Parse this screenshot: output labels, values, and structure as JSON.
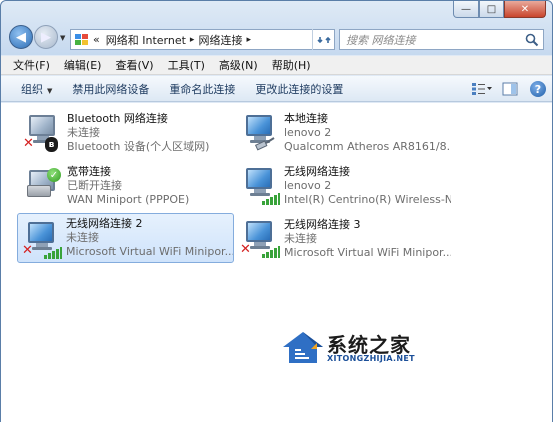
{
  "window": {
    "caption_buttons": {
      "minimize": "—",
      "maximize": "□",
      "close": "✕"
    }
  },
  "nav": {
    "back_icon": "back-arrow-icon",
    "forward_icon": "forward-arrow-icon"
  },
  "address": {
    "prefix": "«",
    "crumbs": [
      "网络和 Internet",
      "网络连接"
    ],
    "separator": "▸"
  },
  "search": {
    "placeholder": "搜索 网络连接"
  },
  "menu": [
    "文件(F)",
    "编辑(E)",
    "查看(V)",
    "工具(T)",
    "高级(N)",
    "帮助(H)"
  ],
  "toolbar": {
    "organize": "组织",
    "disable": "禁用此网络设备",
    "rename": "重命名此连接",
    "change_settings": "更改此连接的设置",
    "help": "?"
  },
  "connections": [
    {
      "name": "Bluetooth 网络连接",
      "status": "未连接",
      "device": "Bluetooth 设备(个人区域网)",
      "icon": "bluetooth-connection-icon",
      "state": "disconnected"
    },
    {
      "name": "本地连接",
      "status": "lenovo  2",
      "device": "Qualcomm Atheros AR8161/8...",
      "icon": "ethernet-connection-icon",
      "state": "connected"
    },
    {
      "name": "宽带连接",
      "status": "已断开连接",
      "device": "WAN Miniport (PPPOE)",
      "icon": "broadband-connection-icon",
      "state": "disconnected"
    },
    {
      "name": "无线网络连接",
      "status": "lenovo  2",
      "device": "Intel(R) Centrino(R) Wireless-N...",
      "icon": "wireless-connection-icon",
      "state": "connected"
    },
    {
      "name": "无线网络连接 2",
      "status": "未连接",
      "device": "Microsoft Virtual WiFi Minipor...",
      "icon": "wireless-connection-icon",
      "state": "disconnected"
    },
    {
      "name": "无线网络连接 3",
      "status": "未连接",
      "device": "Microsoft Virtual WiFi Minipor...",
      "icon": "wireless-connection-icon",
      "state": "disconnected"
    }
  ],
  "watermark": {
    "title": "系统之家",
    "subtitle": "XITONGZHIJIA.NET"
  },
  "colors": {
    "selection": "#cfe3fb",
    "toolbar_text": "#1d3a5f",
    "error_x": "#d42020",
    "signal": "#39a33a"
  }
}
